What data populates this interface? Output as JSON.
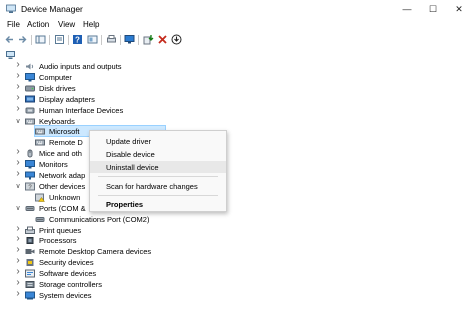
{
  "window": {
    "title": "Device Manager",
    "minimize": "—",
    "maximize": "☐",
    "close": "✕"
  },
  "menu": [
    "File",
    "Action",
    "View",
    "Help"
  ],
  "tree": [
    {
      "label": "Audio inputs and outputs",
      "expanded": false,
      "icon": "speaker-icon"
    },
    {
      "label": "Computer",
      "expanded": false,
      "icon": "monitor-icon"
    },
    {
      "label": "Disk drives",
      "expanded": false,
      "icon": "disk-icon"
    },
    {
      "label": "Display adapters",
      "expanded": false,
      "icon": "display-adapter-icon"
    },
    {
      "label": "Human Interface Devices",
      "expanded": false,
      "icon": "hid-icon"
    },
    {
      "label": "Keyboards",
      "expanded": true,
      "icon": "keyboard-icon"
    },
    {
      "label": "Microsoft",
      "child": true,
      "selected": true,
      "icon": "keyboard-icon"
    },
    {
      "label": "Remote D",
      "child": true,
      "icon": "keyboard-icon"
    },
    {
      "label": "Mice and oth",
      "expanded": false,
      "icon": "mouse-icon"
    },
    {
      "label": "Monitors",
      "expanded": false,
      "icon": "monitor-icon"
    },
    {
      "label": "Network adap",
      "expanded": false,
      "icon": "network-icon"
    },
    {
      "label": "Other devices",
      "expanded": true,
      "icon": "other-devices-icon"
    },
    {
      "label": "Unknown",
      "child": true,
      "icon": "unknown-device-icon"
    },
    {
      "label": "Ports (COM &",
      "expanded": true,
      "icon": "port-icon"
    },
    {
      "label": "Communications Port (COM2)",
      "child": true,
      "icon": "port-icon"
    },
    {
      "label": "Print queues",
      "expanded": false,
      "icon": "printer-icon"
    },
    {
      "label": "Processors",
      "expanded": false,
      "icon": "processor-icon"
    },
    {
      "label": "Remote Desktop Camera devices",
      "expanded": false,
      "icon": "camera-icon"
    },
    {
      "label": "Security devices",
      "expanded": false,
      "icon": "security-icon"
    },
    {
      "label": "Software devices",
      "expanded": false,
      "icon": "software-icon"
    },
    {
      "label": "Storage controllers",
      "expanded": false,
      "icon": "storage-icon"
    },
    {
      "label": "System devices",
      "expanded": false,
      "icon": "system-icon"
    }
  ],
  "context_menu": {
    "items": [
      {
        "label": "Update driver"
      },
      {
        "label": "Disable device"
      },
      {
        "label": "Uninstall device",
        "highlighted": true
      },
      {
        "label": "Scan for hardware changes"
      },
      {
        "label": "Properties",
        "bold": true
      }
    ]
  },
  "colors": {
    "selection": "#cce8ff",
    "accent": "#0078d4",
    "delete": "#c42b1c",
    "update": "#107c10"
  }
}
